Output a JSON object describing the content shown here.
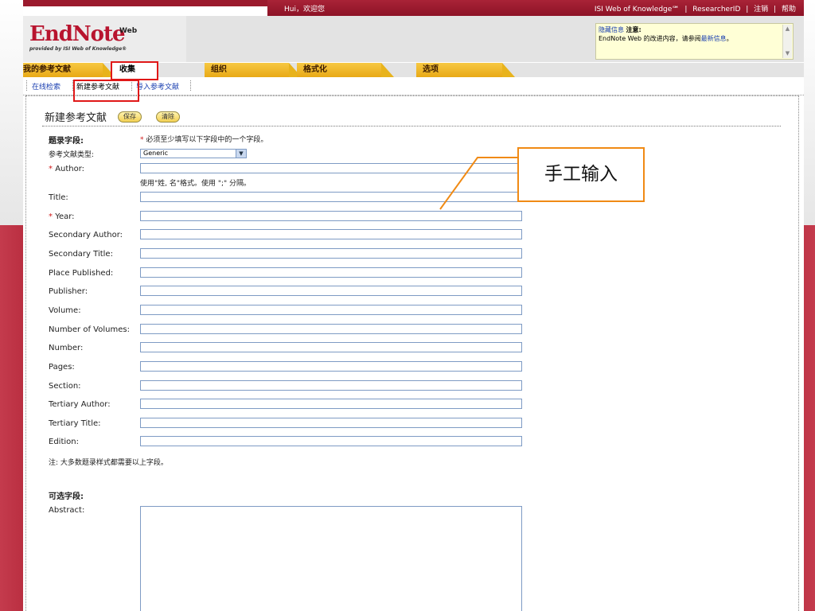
{
  "topbar": {
    "greeting": "Hui，欢迎您",
    "links": [
      "ISI Web of Knowledge℠",
      "ResearcherID",
      "注销",
      "帮助"
    ],
    "separator": "|"
  },
  "logo": {
    "main": "EndNote",
    "suffix": "Web",
    "tagline": "provided by ISI Web of Knowledge®"
  },
  "notice": {
    "hide_link": "隐藏信息",
    "title": "注意:",
    "text": "EndNote Web 的改进内容，请参阅",
    "link": "最新信息",
    "end": "。"
  },
  "tabs": [
    "我的参考文献",
    "收集",
    "组织",
    "格式化",
    "选项"
  ],
  "active_tab": "收集",
  "subnav": [
    "在线检索",
    "新建参考文献",
    "导入参考文献"
  ],
  "active_subnav": "新建参考文献",
  "form": {
    "title": "新建参考文献",
    "save_button": "保存",
    "clear_button": "清除",
    "record_fields_label": "题录字段:",
    "required_note_star": "*",
    "required_note": "必须至少填写以下字段中的一个字段。",
    "ref_type_label": "参考文献类型:",
    "ref_type_value": "Generic",
    "author_hint": "使用\"姓, 名\"格式。使用 \";\" 分隔。",
    "fields": [
      {
        "label": "Author:",
        "required": true
      },
      {
        "label": "Title:",
        "required": false
      },
      {
        "label": "Year:",
        "required": true
      },
      {
        "label": "Secondary Author:",
        "required": false
      },
      {
        "label": "Secondary Title:",
        "required": false
      },
      {
        "label": "Place Published:",
        "required": false
      },
      {
        "label": "Publisher:",
        "required": false
      },
      {
        "label": "Volume:",
        "required": false
      },
      {
        "label": "Number of Volumes:",
        "required": false
      },
      {
        "label": "Number:",
        "required": false
      },
      {
        "label": "Pages:",
        "required": false
      },
      {
        "label": "Section:",
        "required": false
      },
      {
        "label": "Tertiary Author:",
        "required": false
      },
      {
        "label": "Tertiary Title:",
        "required": false
      },
      {
        "label": "Edition:",
        "required": false
      }
    ],
    "footnote": "注: 大多数题录样式都需要以上字段。",
    "optional_label": "可选字段:",
    "abstract_label": "Abstract:"
  },
  "callout": {
    "text": "手工输入"
  },
  "colors": {
    "brand_red": "#b8142e",
    "tab_gold": "#f3c236",
    "highlight_red": "#e01818",
    "callout_orange": "#f08a14",
    "link_blue": "#1a3fb0"
  }
}
